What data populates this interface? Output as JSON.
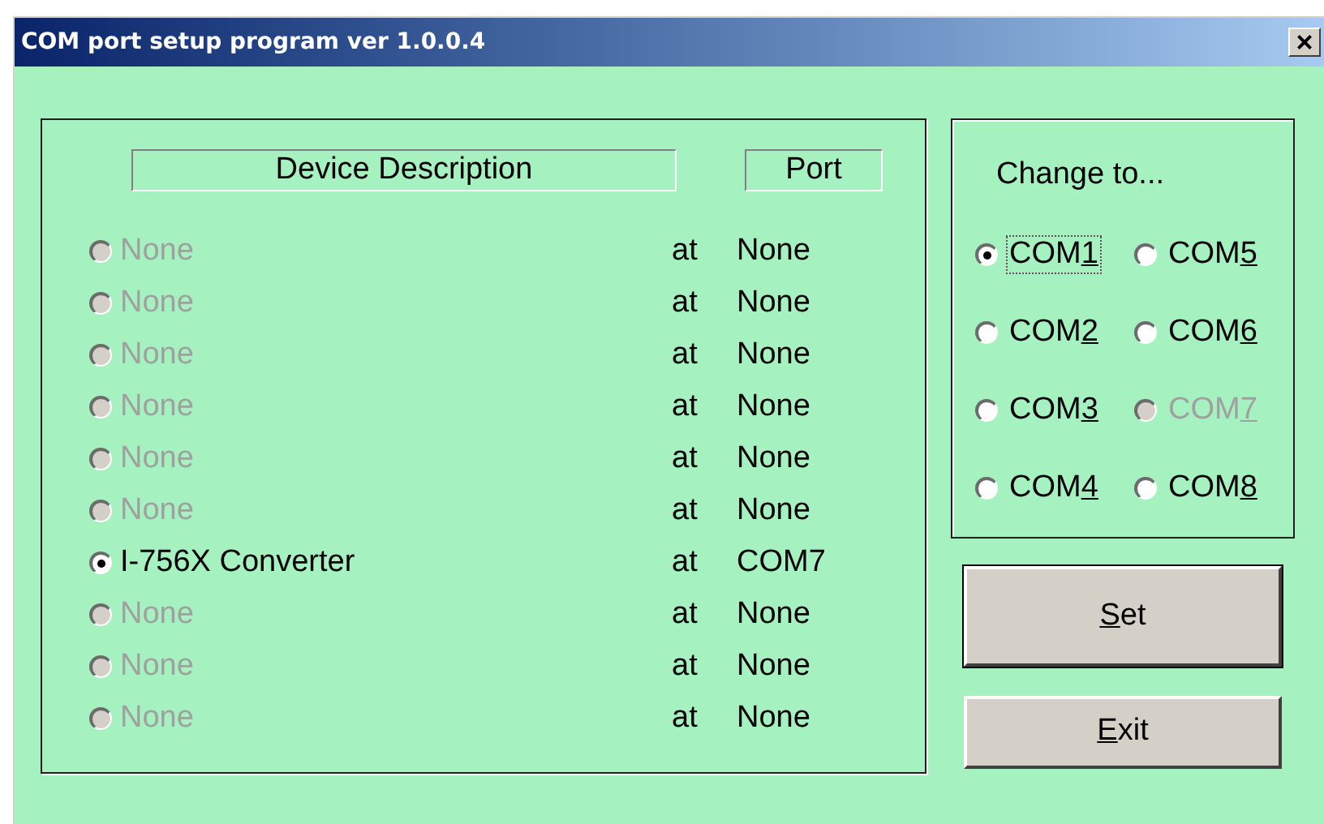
{
  "window": {
    "title": "COM port setup program ver 1.0.0.4",
    "close_glyph": "×"
  },
  "devices": {
    "columns": [
      "Device Description",
      "Port"
    ],
    "rows": [
      {
        "description": "None",
        "at": "at",
        "port": "None",
        "selected": false,
        "disabled": true
      },
      {
        "description": "None",
        "at": "at",
        "port": "None",
        "selected": false,
        "disabled": true
      },
      {
        "description": "None",
        "at": "at",
        "port": "None",
        "selected": false,
        "disabled": true
      },
      {
        "description": "None",
        "at": "at",
        "port": "None",
        "selected": false,
        "disabled": true
      },
      {
        "description": "None",
        "at": "at",
        "port": "None",
        "selected": false,
        "disabled": true
      },
      {
        "description": "None",
        "at": "at",
        "port": "None",
        "selected": false,
        "disabled": true
      },
      {
        "description": "I-756X Converter",
        "at": "at",
        "port": "COM7",
        "selected": true,
        "disabled": false
      },
      {
        "description": "None",
        "at": "at",
        "port": "None",
        "selected": false,
        "disabled": true
      },
      {
        "description": "None",
        "at": "at",
        "port": "None",
        "selected": false,
        "disabled": true
      },
      {
        "description": "None",
        "at": "at",
        "port": "None",
        "selected": false,
        "disabled": true
      }
    ]
  },
  "change_to": {
    "title": "Change to...",
    "options": [
      {
        "prefix": "COM",
        "mnemonic": "1",
        "selected": true,
        "disabled": false,
        "focused": true
      },
      {
        "prefix": "COM",
        "mnemonic": "5",
        "selected": false,
        "disabled": false,
        "focused": false
      },
      {
        "prefix": "COM",
        "mnemonic": "2",
        "selected": false,
        "disabled": false,
        "focused": false
      },
      {
        "prefix": "COM",
        "mnemonic": "6",
        "selected": false,
        "disabled": false,
        "focused": false
      },
      {
        "prefix": "COM",
        "mnemonic": "3",
        "selected": false,
        "disabled": false,
        "focused": false
      },
      {
        "prefix": "COM",
        "mnemonic": "7",
        "selected": false,
        "disabled": true,
        "focused": false
      },
      {
        "prefix": "COM",
        "mnemonic": "4",
        "selected": false,
        "disabled": false,
        "focused": false
      },
      {
        "prefix": "COM",
        "mnemonic": "8",
        "selected": false,
        "disabled": false,
        "focused": false
      }
    ]
  },
  "buttons": [
    {
      "mnemonic": "S",
      "suffix": "et",
      "default": true
    },
    {
      "mnemonic": "E",
      "suffix": "xit",
      "default": false
    }
  ]
}
